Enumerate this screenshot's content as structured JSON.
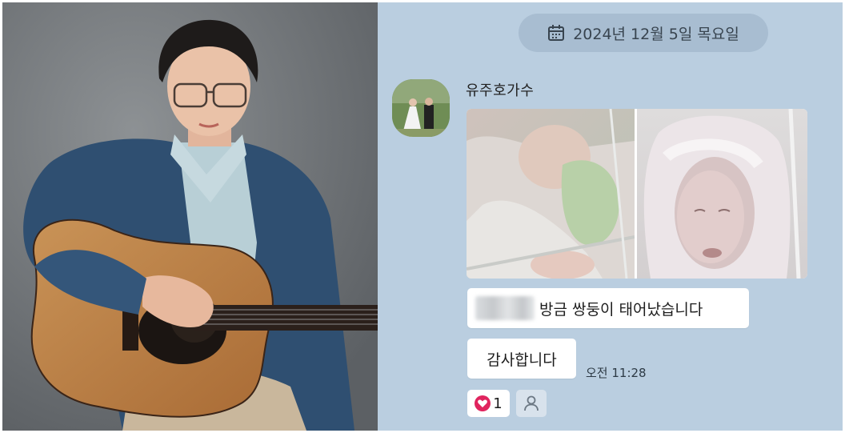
{
  "chat": {
    "date_label": "2024년 12월 5일 목요일",
    "sender_name": "유주호가수",
    "message_1": "방금 쌍둥이 태어났습니다",
    "message_2": "감사합니다",
    "time": "오전 11:28",
    "reaction_count": "1"
  },
  "colors": {
    "chat_background": "#bacee0",
    "date_pill": "#a8bdd1",
    "bubble": "#ffffff",
    "reaction_heart": "#e0245e"
  },
  "icons": {
    "date": "calendar-icon",
    "reaction": "heart-icon",
    "add_reaction": "person-icon"
  }
}
